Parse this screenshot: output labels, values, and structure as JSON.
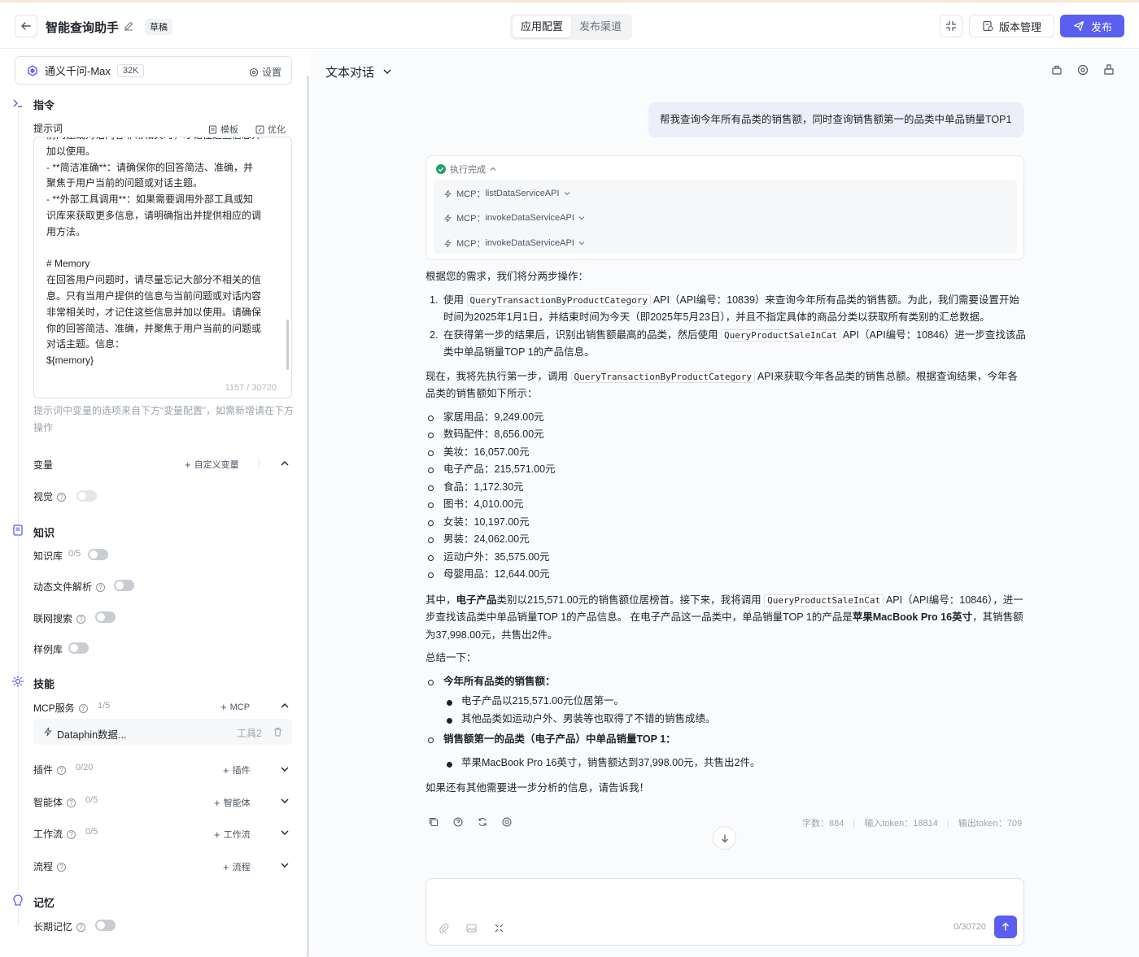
{
  "header": {
    "title": "智能查询助手",
    "draft_badge": "草稿",
    "tabs": [
      {
        "label": "应用配置",
        "active": true
      },
      {
        "label": "发布渠道",
        "active": false
      }
    ],
    "version_label": "版本管理",
    "publish_label": "发布",
    "accent_color": "#5b5ef0"
  },
  "left": {
    "model": {
      "name": "通义千问-Max",
      "context": "32K",
      "settings_label": "设置"
    },
    "instructions": {
      "title": "指令",
      "prompt_label": "提示词",
      "template_label": "模板",
      "optimize_label": "优化",
      "prompt_text": "前问题或对话内容非常相关时，才记住这些信息并\n加以使用。\n- **简洁准确**：请确保你的回答简洁、准确，并\n聚焦于用户当前的问题或对话主题。\n- **外部工具调用**：如果需要调用外部工具或知\n识库来获取更多信息，请明确指出并提供相应的调\n用方法。\n\n# Memory\n在回答用户问题时，请尽量忘记大部分不相关的信\n息。只有当用户提供的信息与当前问题或对话内容\n非常相关时，才记住这些信息并加以使用。请确保\n你的回答简洁、准确，并聚焦于用户当前的问题或\n对话主题。信息：\n${memory}",
      "char_count": "1157 / 30720",
      "hint": "提示词中变量的选项来自下方“变量配置”，如需新增请在下方操作"
    },
    "variables": {
      "label": "变量",
      "add_label": "自定义变量"
    },
    "vision": {
      "label": "视觉",
      "enabled": false
    },
    "knowledge": {
      "title": "知识",
      "kb_label": "知识库",
      "kb_count": "0/5",
      "dynamic_file_label": "动态文件解析",
      "web_search_label": "联网搜索",
      "sample_label": "样例库"
    },
    "skills": {
      "title": "技能",
      "mcp_label": "MCP服务",
      "mcp_count": "1/5",
      "mcp_add": "MCP",
      "mcp_item": {
        "name": "Dataphin数据...",
        "tools": "工具2"
      },
      "plugin_label": "插件",
      "plugin_count": "0/20",
      "plugin_add": "插件",
      "agent_label": "智能体",
      "agent_count": "0/5",
      "agent_add": "智能体",
      "workflow_label": "工作流",
      "workflow_count": "0/5",
      "workflow_add": "工作流",
      "flow_label": "流程",
      "flow_add": "流程"
    },
    "memory": {
      "title": "记忆",
      "long_term_label": "长期记忆"
    }
  },
  "chat": {
    "mode": "文本对话",
    "user_message": "帮我查询今年所有品类的销售额，同时查询销售额第一的品类中单品销量TOP1",
    "exec_status": "执行完成",
    "mcp_calls": [
      {
        "prefix": "MCP：",
        "name": "listDataServiceAPI"
      },
      {
        "prefix": "MCP：",
        "name": "invokeDataServiceAPI"
      },
      {
        "prefix": "MCP：",
        "name": "invokeDataServiceAPI"
      }
    ],
    "answer": {
      "intro": "根据您的需求，我们将分两步操作：",
      "step1_a": "使用",
      "step1_code": "QueryTransactionByProductCategory",
      "step1_b": "API（API编号：10839）来查询今年所有品类的销售额。为此，我们需要设置开始时间为2025年1月1日，并结束时间为今天（即2025年5月23日），并且不指定具体的商品分类以获取所有类别的汇总数据。",
      "step2_a": "在获得第一步的结果后，识别出销售额最高的品类，然后使用",
      "step2_code": "QueryProductSaleInCat",
      "step2_b": "API（API编号：10846）进一步查找该品类中单品销量TOP 1的产品信息。",
      "now_a": "现在，我将先执行第一步，调用",
      "now_code": "QueryTransactionByProductCategory",
      "now_b": "API来获取今年各品类的销售总额。根据查询结果，今年各品类的销售额如下所示：",
      "sales": [
        "家居用品：9,249.00元",
        "数码配件：8,656.00元",
        "美妆：16,057.00元",
        "电子产品：215,571.00元",
        "食品：1,172.30元",
        "图书：4,010.00元",
        "女装：10,197.00元",
        "男装：24,062.00元",
        "运动户外：35,575.00元",
        "母婴用品：12,644.00元"
      ],
      "mid_a": "其中，",
      "mid_bold": "电子产品",
      "mid_b": "类别以215,571.00元的销售额位居榜首。接下来，我将调用",
      "mid_code": "QueryProductSaleInCat",
      "mid_c": "API（API编号：10846），进一步查找该品类中单品销量TOP 1的产品信息。 在电子产品这一品类中，单品销量TOP 1的产品是",
      "mid_bold2": "苹果MacBook Pro 16英寸",
      "mid_d": "，其销售额为37,998.00元，共售出2件。",
      "summary_label": "总结一下：",
      "sum1_title": "今年所有品类的销售额",
      "sum1_items": [
        "电子产品以215,571.00元位居第一。",
        "其他品类如运动户外、男装等也取得了不错的销售成绩。"
      ],
      "sum2_title": "销售额第一的品类（电子产品）中单品销量TOP 1",
      "sum2_items": [
        "苹果MacBook Pro 16英寸，销售额达到37,998.00元，共售出2件。"
      ],
      "closing": "如果还有其他需要进一步分析的信息，请告诉我！"
    },
    "stats": {
      "chars": "字数：884",
      "input_tokens": "输入token：18814",
      "output_tokens": "输出token：709"
    },
    "input_count": "0/30720"
  }
}
